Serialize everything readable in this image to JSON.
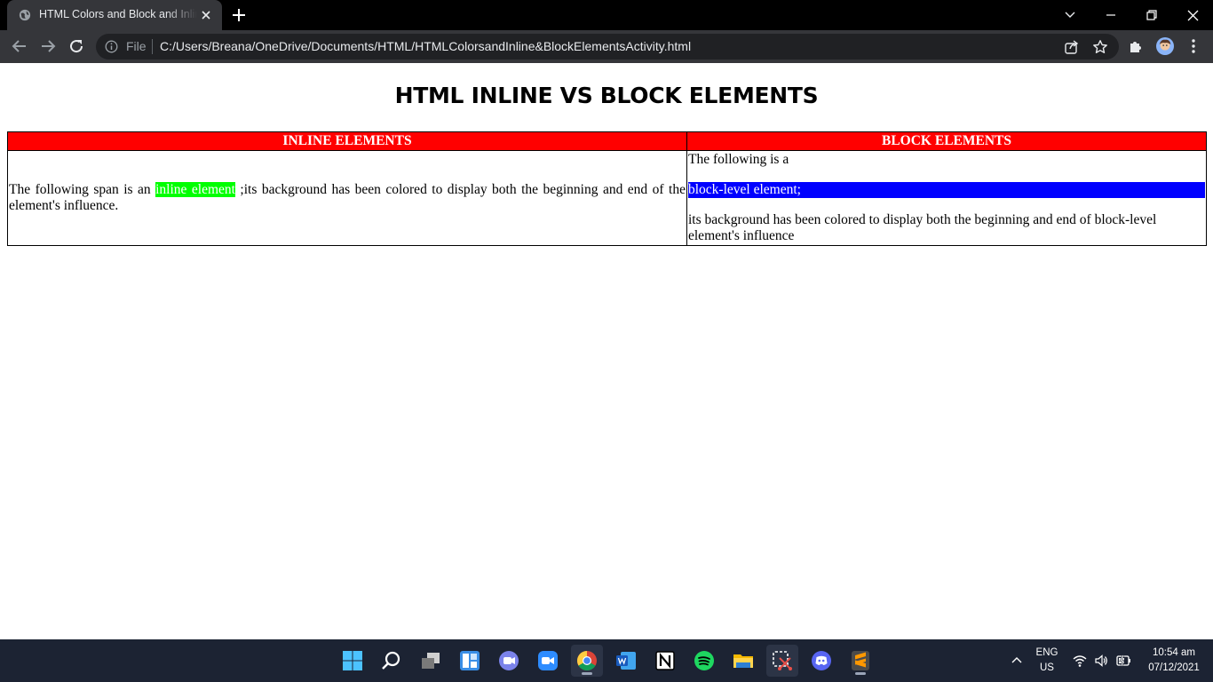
{
  "browser": {
    "tab_title": "HTML Colors and Block and Inline Elements Activity",
    "file_label": "File",
    "url": "C:/Users/Breana/OneDrive/Documents/HTML/HTMLColorsandInline&BlockElementsActivity.html"
  },
  "page": {
    "heading": "HTML INLINE VS BLOCK ELEMENTS",
    "table": {
      "headers": [
        "INLINE ELEMENTS",
        "BLOCK ELEMENTS"
      ],
      "inline": {
        "before": "The following span is an ",
        "span": "inline element",
        "after": " ;its background has been colored to display both the beginning and end of the element's influence."
      },
      "block": {
        "before": "The following is a",
        "div": "block-level element;",
        "after": "its background has been colored to display both the beginning and end of block-level element's influence"
      }
    },
    "colors": {
      "header_bg": "#ff0000",
      "inline_span_bg": "#00ff00",
      "block_div_bg": "#0000ff"
    }
  },
  "taskbar": {
    "language": "ENG",
    "region": "US",
    "time": "10:54 am",
    "date": "07/12/2021",
    "apps": [
      "start-icon",
      "search-icon",
      "task-view-icon",
      "widgets-icon",
      "teams-chat-icon",
      "zoom-icon",
      "chrome-icon",
      "word-icon",
      "notion-icon",
      "spotify-icon",
      "file-explorer-icon",
      "snipping-tool-icon",
      "discord-icon",
      "sublime-text-icon"
    ]
  }
}
